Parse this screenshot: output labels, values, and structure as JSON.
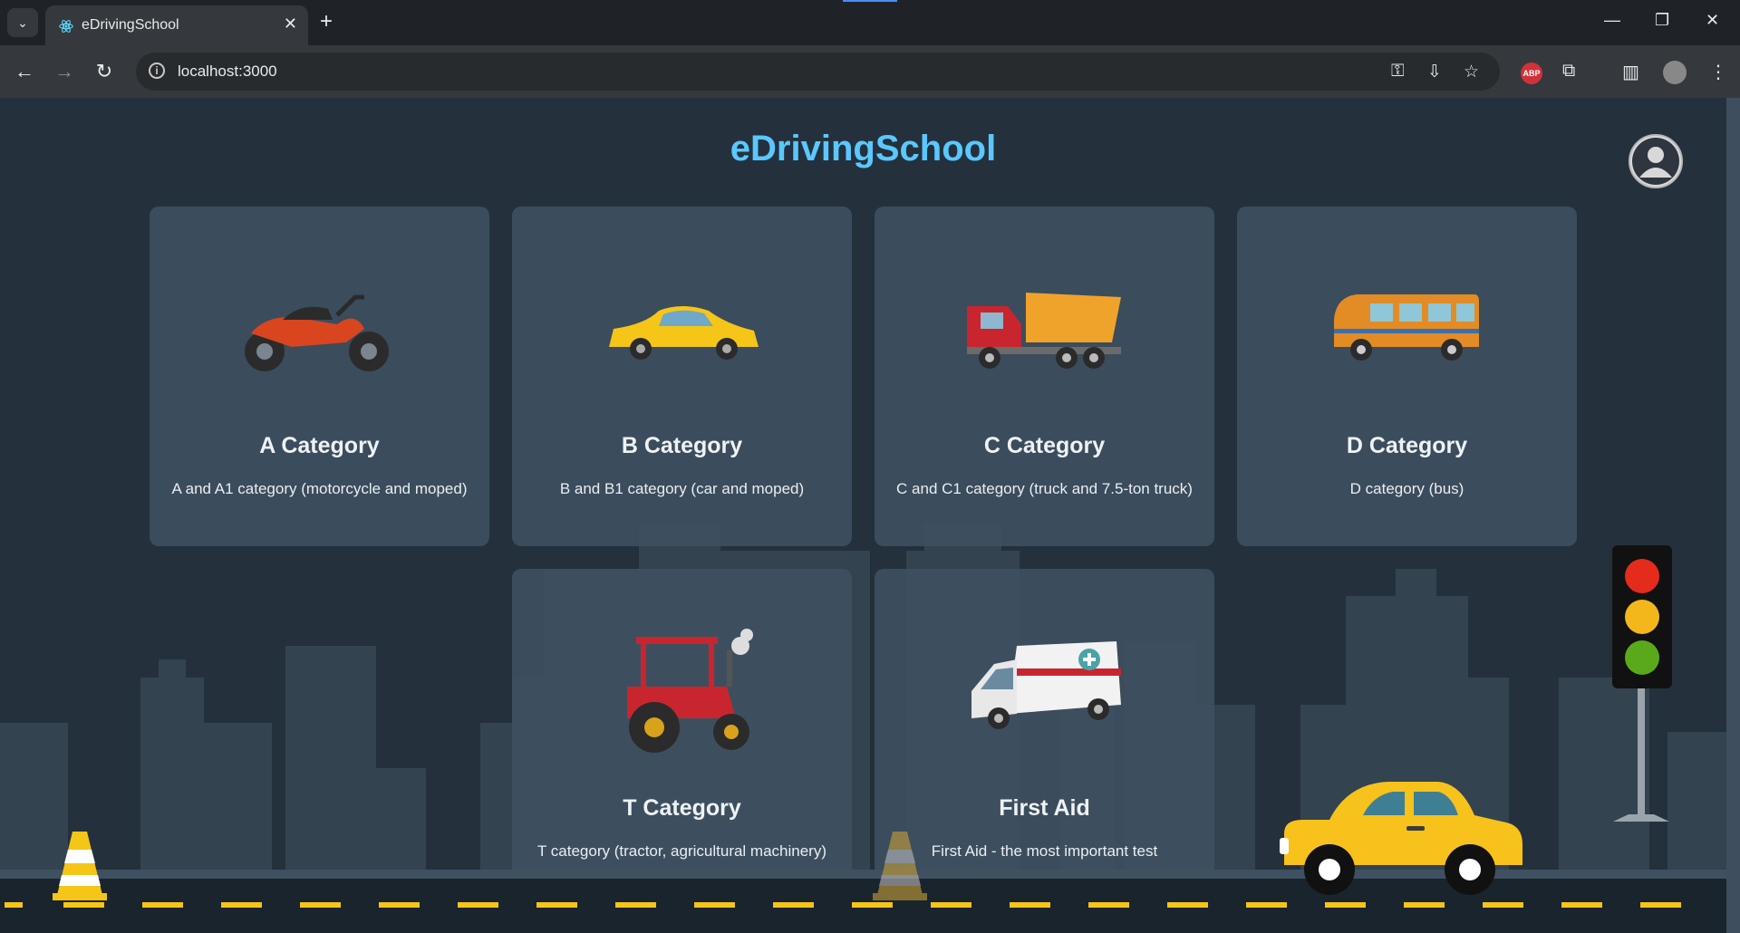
{
  "browser": {
    "tab_title": "eDrivingSchool",
    "url": "localhost:3000",
    "abp_label": "ABP"
  },
  "page": {
    "title": "eDrivingSchool"
  },
  "cards": [
    {
      "title": "A Category",
      "description": "A and A1 category (motorcycle and moped)"
    },
    {
      "title": "B Category",
      "description": "B and B1 category (car and moped)"
    },
    {
      "title": "C Category",
      "description": "C and C1 category (truck and 7.5-ton truck)"
    },
    {
      "title": "D Category",
      "description": "D category (bus)"
    },
    {
      "title": "T Category",
      "description": "T category (tractor, agricultural machinery)"
    },
    {
      "title": "First Aid",
      "description": "First Aid - the most important test"
    }
  ],
  "colors": {
    "accent": "#5ac8ff",
    "background": "#24313d",
    "card": "#3f5162"
  }
}
